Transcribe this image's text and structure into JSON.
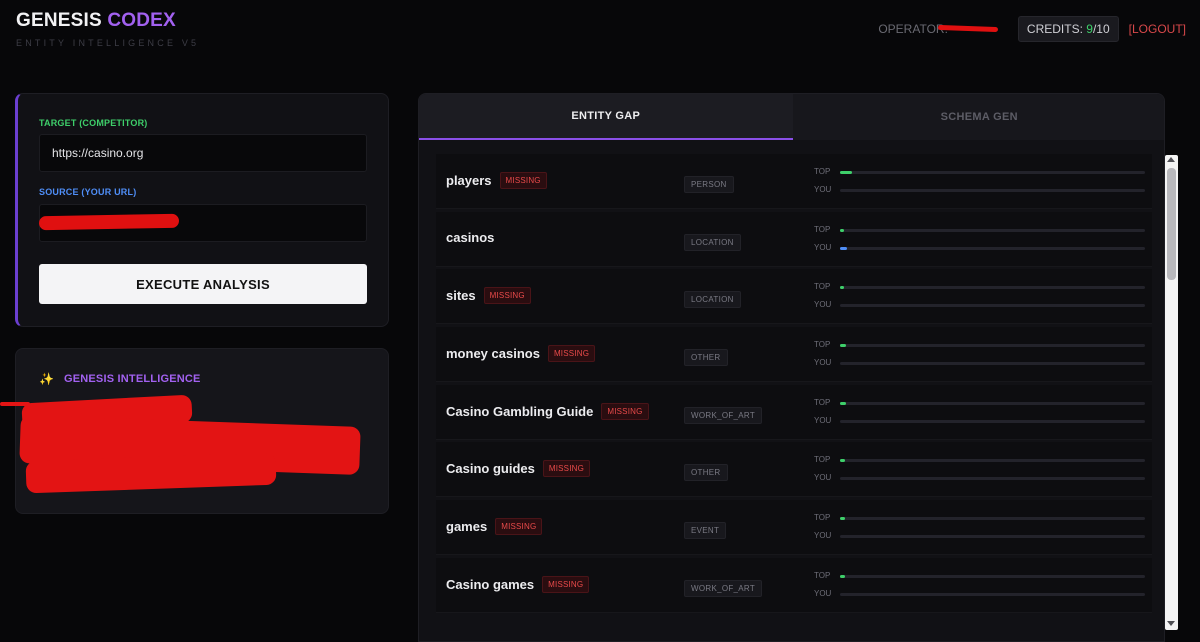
{
  "brand": {
    "title_main": "GENESIS",
    "title_accent": "CODEX",
    "subtitle": "ENTITY INTELLIGENCE V5"
  },
  "topbar": {
    "operator_label": "OPERATOR:",
    "credits_label": "CREDITS:",
    "credits_used": "9",
    "credits_total": "/10",
    "logout": "[LOGOUT]"
  },
  "form": {
    "target_label": "TARGET (COMPETITOR)",
    "target_value": "https://casino.org",
    "source_label": "SOURCE (YOUR URL)",
    "execute_label": "EXECUTE ANALYSIS"
  },
  "intelligence": {
    "icon": "sparkles-icon",
    "title": "GENESIS INTELLIGENCE"
  },
  "tabs": [
    {
      "label": "ENTITY GAP",
      "active": true
    },
    {
      "label": "SCHEMA GEN",
      "active": false
    }
  ],
  "bar_labels": {
    "top": "TOP",
    "you": "YOU"
  },
  "missing_label": "MISSING",
  "entities": [
    {
      "name": "players",
      "missing": true,
      "type": "PERSON",
      "top": 0.04,
      "you": 0
    },
    {
      "name": "casinos",
      "missing": false,
      "type": "LOCATION",
      "top": 0.01,
      "you": 0.02
    },
    {
      "name": "sites",
      "missing": true,
      "type": "LOCATION",
      "top": 0.01,
      "you": 0
    },
    {
      "name": "money casinos",
      "missing": true,
      "type": "OTHER",
      "top": 0.02,
      "you": 0
    },
    {
      "name": "Casino Gambling Guide",
      "missing": true,
      "type": "WORK_OF_ART",
      "top": 0.02,
      "you": 0
    },
    {
      "name": "Casino guides",
      "missing": true,
      "type": "OTHER",
      "top": 0.015,
      "you": 0
    },
    {
      "name": "games",
      "missing": true,
      "type": "EVENT",
      "top": 0.015,
      "you": 0
    },
    {
      "name": "Casino games",
      "missing": true,
      "type": "WORK_OF_ART",
      "top": 0.015,
      "you": 0
    }
  ],
  "colors": {
    "accent": "#a261f0",
    "top_bar": "#3ecf6a",
    "you_bar": "#4f8ef7",
    "missing": "#e84a4a"
  }
}
